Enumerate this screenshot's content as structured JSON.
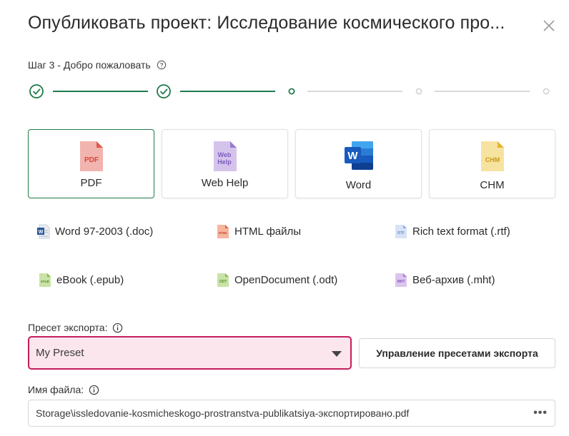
{
  "dialog": {
    "title": "Опубликовать проект: Исследование космического про...",
    "step_label": "Шаг 3 - Добро пожаловать"
  },
  "stepper": {
    "current_step": 3,
    "total_steps": 5,
    "completed_color": "#1f7a4c",
    "pending_color": "#d0d0d0"
  },
  "formats_primary": [
    {
      "label": "PDF",
      "icon": "pdf-file-icon",
      "selected": true
    },
    {
      "label": "Web Help",
      "icon": "webhelp-file-icon",
      "selected": false
    },
    {
      "label": "Word",
      "icon": "word-app-icon",
      "selected": false
    },
    {
      "label": "CHM",
      "icon": "chm-file-icon",
      "selected": false
    }
  ],
  "formats_secondary": [
    {
      "label": "Word 97-2003 (.doc)",
      "icon": "doc-file-icon"
    },
    {
      "label": "HTML файлы",
      "icon": "html-file-icon"
    },
    {
      "label": "Rich text format (.rtf)",
      "icon": "rtf-file-icon"
    },
    {
      "label": "eBook (.epub)",
      "icon": "epub-file-icon"
    },
    {
      "label": "OpenDocument (.odt)",
      "icon": "odt-file-icon"
    },
    {
      "label": "Веб-архив (.mht)",
      "icon": "mht-file-icon"
    }
  ],
  "preset": {
    "label": "Пресет экспорта:",
    "value": "My Preset",
    "manage_button": "Управление пресетами экспорта"
  },
  "file": {
    "label": "Имя файла:",
    "value": "Storage\\issledovanie-kosmicheskogo-prostranstva-publikatsiya-экспортировано.pdf",
    "more": "•••"
  },
  "icon_text": {
    "pdf": "PDF",
    "webhelp_1": "Web",
    "webhelp_2": "Help",
    "word": "W",
    "chm": "CHM",
    "html": "HTML",
    "rtf": "RTF",
    "epub": "EPUB",
    "odt": "ODT",
    "mht": "MHT"
  },
  "colors": {
    "accent": "#1f7a4c",
    "preset_border": "#c51e5c",
    "preset_bg": "#fce6ee"
  }
}
